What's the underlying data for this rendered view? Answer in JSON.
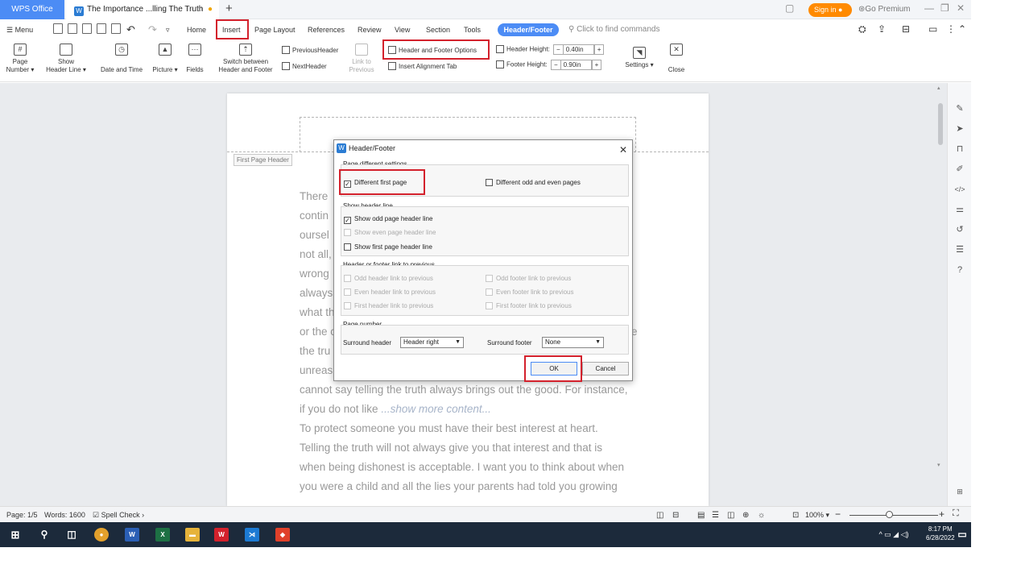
{
  "tabs": {
    "home": "WPS Office",
    "doc_title": "The Importance ...lling The Truth",
    "new_tab": "+"
  },
  "titlebar": {
    "sign_in": "Sign in",
    "premium": "Go Premium"
  },
  "menu": {
    "menu": "Menu",
    "items": [
      "Home",
      "Insert",
      "Page Layout",
      "References",
      "Review",
      "View",
      "Section",
      "Tools"
    ],
    "active_tab": "Header/Footer",
    "find_placeholder": "Click to find commands"
  },
  "ribbon": {
    "page_number": [
      "Page",
      "Number"
    ],
    "show_header_line": [
      "Show",
      "Header Line"
    ],
    "date_time": "Date and Time",
    "picture": "Picture",
    "fields": "Fields",
    "switch": [
      "Switch between",
      "Header and Footer"
    ],
    "prev_header": "PreviousHeader",
    "next_header": "NextHeader",
    "link_prev": [
      "Link to",
      "Previous"
    ],
    "hf_options": "Header and Footer Options",
    "align_tab": "Insert Alignment Tab",
    "header_height_label": "Header Height:",
    "header_height": "0.40in",
    "footer_height_label": "Footer Height:",
    "footer_height": "0.90in",
    "settings": "Settings",
    "close": "Close"
  },
  "document": {
    "first_page_header": "First Page Header",
    "lines": [
      "There",
      "contin",
      "oursel",
      "not all,",
      "wrong",
      "always",
      "what th",
      "or the c",
      "the tru",
      "unreas",
      "cannot say telling the truth always brings out the good. For instance,",
      "if you do not like ",
      "To protect someone you must have their best interest at heart.",
      "Telling the truth will not always give you that interest and that is",
      "when being dishonest is acceptable. I want you to think about when",
      "you were a child and all the lies your parents had told you growing"
    ],
    "show_more": "...show more content...",
    "right_edge_char": "e"
  },
  "dialog": {
    "title": "Header/Footer",
    "group_page_diff": "Page different settings",
    "diff_first": "Different first page",
    "diff_first_checked": true,
    "diff_odd_even": "Different odd and even pages",
    "group_header_line": "Show header line",
    "show_odd": "Show odd page header line",
    "show_even": "Show even page header line",
    "show_first": "Show first page header line",
    "group_link": "Header or footer link to previous",
    "odd_header_link": "Odd header link to previous",
    "even_header_link": "Even header link to previous",
    "first_header_link": "First header link to previous",
    "odd_footer_link": "Odd footer link to previous",
    "even_footer_link": "Even footer link to previous",
    "first_footer_link": "First footer link to previous",
    "group_page_number": "Page number",
    "surround_header_label": "Surround header",
    "surround_header_value": "Header right",
    "surround_footer_label": "Surround footer",
    "surround_footer_value": "None",
    "ok": "OK",
    "cancel": "Cancel"
  },
  "status": {
    "page": "Page: 1/5",
    "words": "Words: 1600",
    "spell": "Spell Check",
    "zoom": "100%"
  },
  "taskbar": {
    "time": "8:17 PM",
    "date": "6/28/2022"
  },
  "colors": {
    "accent": "#4c8cf5",
    "highlight": "#d3212c",
    "taskbar": "#1c2a3b"
  }
}
